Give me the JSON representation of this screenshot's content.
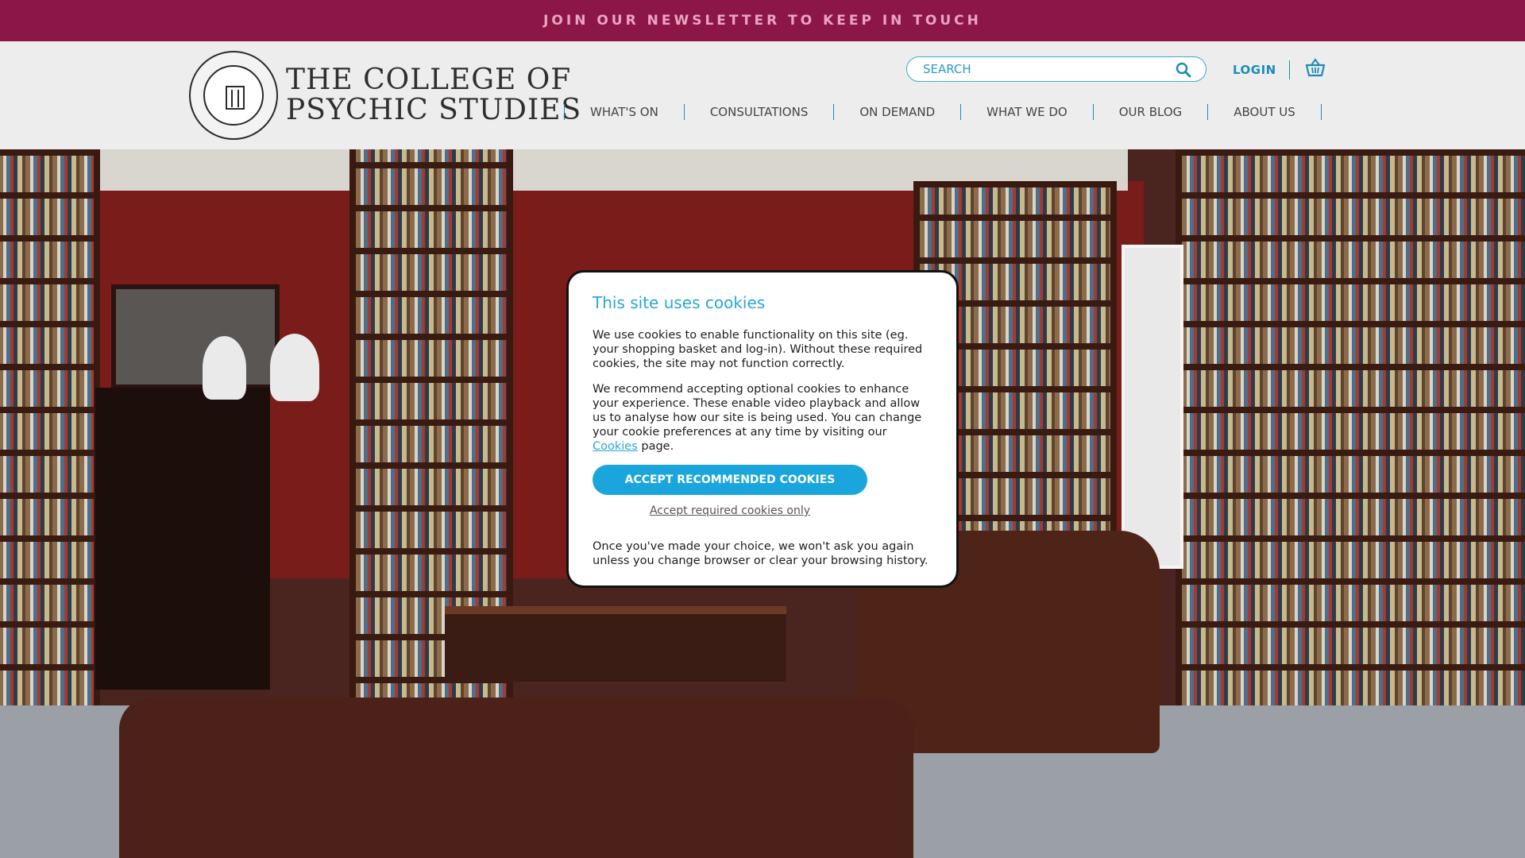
{
  "topbar": {
    "newsletter_label": "JOIN OUR NEWSLETTER TO KEEP IN TOUCH"
  },
  "header": {
    "logo_line1": "THE COLLEGE OF",
    "logo_line2": "PSYCHIC STUDIES",
    "search_placeholder": "SEARCH",
    "login_label": "LOGIN",
    "nav": [
      "WHAT'S ON",
      "CONSULTATIONS",
      "ON DEMAND",
      "WHAT WE DO",
      "OUR BLOG",
      "ABOUT US"
    ]
  },
  "cookie_modal": {
    "title": "This site uses cookies",
    "paragraph1": "We use cookies to enable functionality on this site (eg. your shopping basket and log-in). Without these required cookies, the site may not function correctly.",
    "paragraph2_before": "We recommend accepting optional cookies to enhance your experience. These enable video playback and allow us to analyse how our site is being used. You can change your cookie preferences at any time by visiting our ",
    "paragraph2_link": "Cookies",
    "paragraph2_after": " page.",
    "accept_button": "ACCEPT RECOMMENDED COOKIES",
    "required_link": "Accept required cookies only",
    "footer_text": "Once you've made your choice, we won't ask you again unless you change browser or clear your browsing history."
  },
  "colors": {
    "topbar_bg": "#8c1747",
    "accent_blue": "#1aa6dc",
    "nav_separator": "#1e8bb5"
  },
  "icons": [
    "search-icon",
    "basket-icon",
    "college-seal-logo"
  ]
}
